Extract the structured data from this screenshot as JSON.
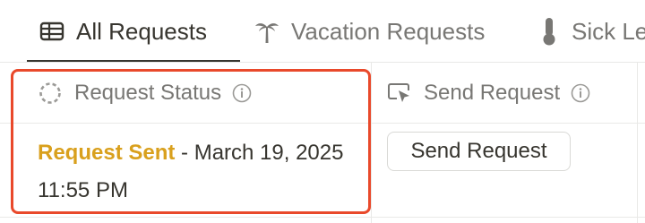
{
  "tabs": [
    {
      "label": "All Requests",
      "icon": "table-icon",
      "active": true
    },
    {
      "label": "Vacation Requests",
      "icon": "palm-tree-icon",
      "active": false
    },
    {
      "label": "Sick Le",
      "icon": "thermometer-icon",
      "active": false
    }
  ],
  "table": {
    "columns": [
      {
        "label": "Request Status",
        "icon": "status-loading-icon"
      },
      {
        "label": "Send Request",
        "icon": "button-cursor-icon"
      }
    ],
    "row": {
      "status_value": "Request Sent",
      "status_suffix": " - March 19, 2025 11:55 PM",
      "send_button_label": "Send Request"
    }
  },
  "colors": {
    "accent_text": "#37352f",
    "muted_text": "#787774",
    "status_sent": "#d9a01d",
    "highlight_border": "#e9492b"
  }
}
